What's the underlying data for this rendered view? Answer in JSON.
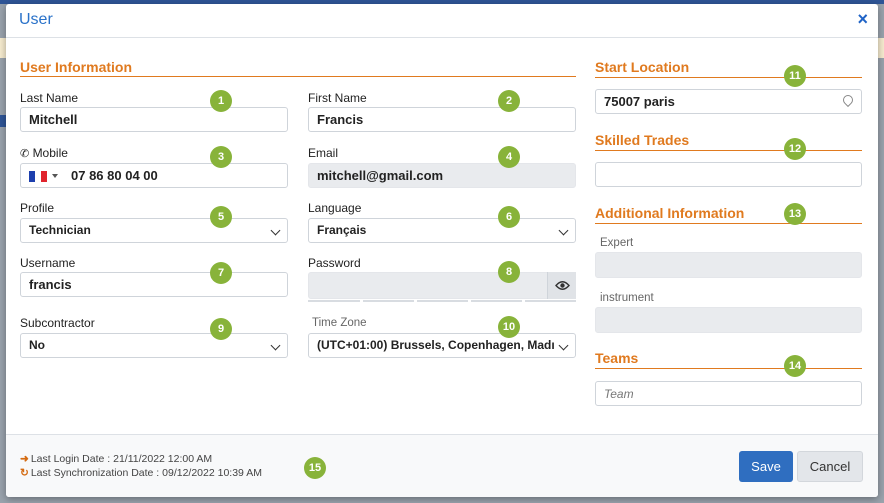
{
  "modal": {
    "title": "User",
    "close_label": "×"
  },
  "sections": {
    "user_info": "User Information",
    "start_location": "Start Location",
    "skilled_trades": "Skilled Trades",
    "additional_info": "Additional Information",
    "teams": "Teams"
  },
  "fields": {
    "last_name": {
      "label": "Last Name",
      "value": "Mitchell"
    },
    "first_name": {
      "label": "First Name",
      "value": "Francis"
    },
    "mobile": {
      "label": "Mobile",
      "value": "07 86 80 04 00",
      "country": "France"
    },
    "email": {
      "label": "Email",
      "value": "mitchell@gmail.com"
    },
    "profile": {
      "label": "Profile",
      "value": "Technician"
    },
    "language": {
      "label": "Language",
      "value": "Français"
    },
    "username": {
      "label": "Username",
      "value": "francis"
    },
    "password": {
      "label": "Password",
      "value": ""
    },
    "subcontractor": {
      "label": "Subcontractor",
      "value": "No"
    },
    "timezone": {
      "label": "Time Zone",
      "value": "(UTC+01:00) Brussels, Copenhagen, Madı"
    },
    "start_location": {
      "value": "75007 paris"
    },
    "skilled_trades": {
      "value": ""
    },
    "expert": {
      "label": "Expert",
      "value": ""
    },
    "instrument": {
      "label": "instrument",
      "value": ""
    },
    "team": {
      "placeholder": "Team"
    }
  },
  "badges": [
    "1",
    "2",
    "3",
    "4",
    "5",
    "6",
    "7",
    "8",
    "9",
    "10",
    "11",
    "12",
    "13",
    "14",
    "15"
  ],
  "footer": {
    "last_login": "Last Login Date : 21/11/2022 12:00 AM",
    "last_sync": "Last Synchronization Date : 09/12/2022 10:39 AM",
    "save_label": "Save",
    "cancel_label": "Cancel"
  },
  "colors": {
    "accent": "#e07a1f",
    "title_blue": "#2a72c9",
    "badge_green": "#88b33a",
    "save_blue": "#2f6ec0"
  },
  "icons": {
    "mobile": "phone-icon",
    "password_toggle": "eye-icon",
    "location": "map-pin-icon",
    "login": "sign-in-icon",
    "sync": "refresh-icon"
  }
}
